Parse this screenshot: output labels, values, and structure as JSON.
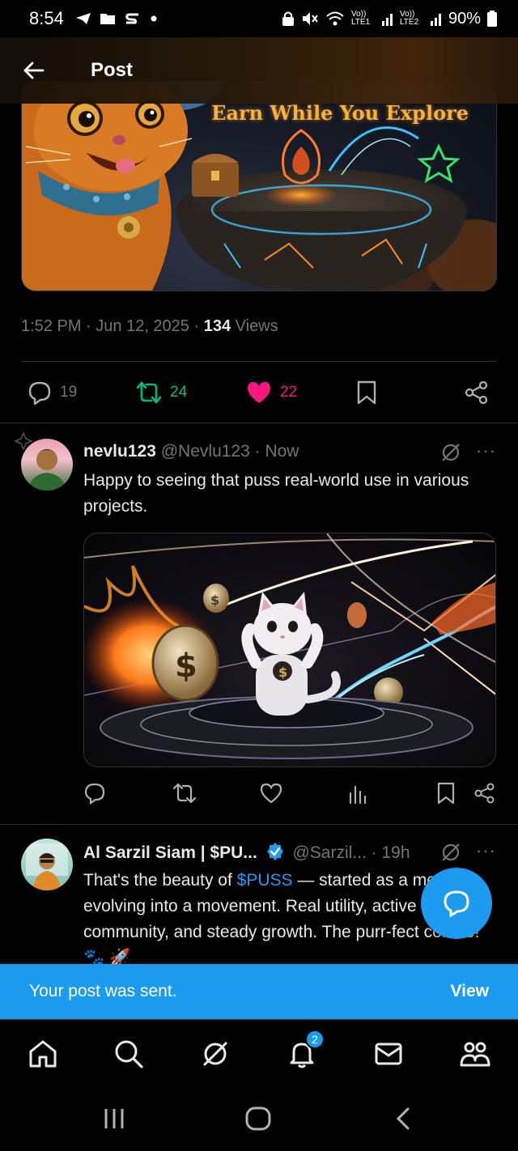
{
  "status_bar": {
    "time": "8:54",
    "network1": "Vo)) LTE1",
    "network2": "Vo)) LTE2",
    "battery": "90%"
  },
  "header": {
    "title": "Post"
  },
  "banner": {
    "caption": "Earn While You Explore"
  },
  "post_meta": {
    "time": "1:52 PM",
    "date": "Jun 12, 2025",
    "views_count": "134",
    "views_label": "Views"
  },
  "main_actions": {
    "replies": "19",
    "reposts": "24",
    "likes": "22"
  },
  "replies": [
    {
      "name": "nevlu123",
      "handle": "@Nevlu123",
      "time": "Now",
      "text": "Happy to seeing that puss real-world use in various projects."
    },
    {
      "name": "Al Sarzil Siam | $PU...",
      "handle": "@Sarzil...",
      "time": "19h",
      "text_before": "That's the beauty of ",
      "text_link": "$PUSS",
      "text_after": " — started as a meme, evolving into a movement. Real utility, active community, and steady growth. The purr-fect combo! 🐾 🚀"
    }
  ],
  "toast": {
    "message": "Your post was sent.",
    "action": "View"
  },
  "bottom_nav": {
    "notifications_badge": "2"
  },
  "colors": {
    "accent": "#1d9bf0",
    "like": "#f91880",
    "repost": "#00ba7c",
    "muted": "#71767b"
  }
}
